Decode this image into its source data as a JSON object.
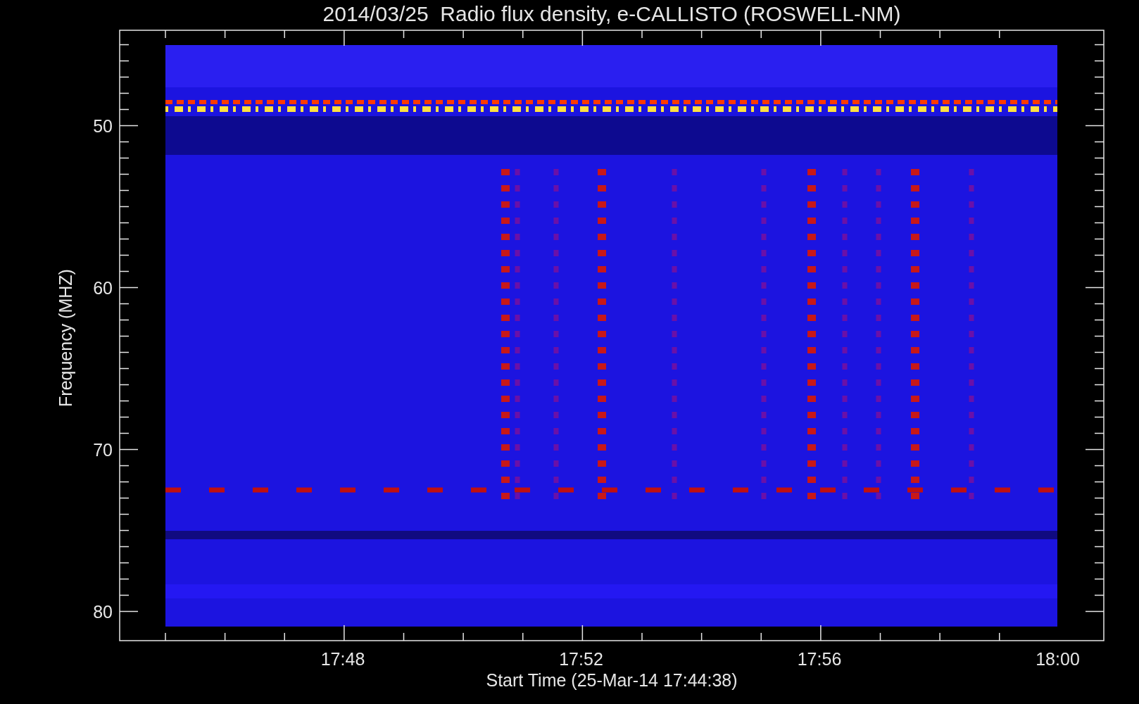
{
  "title": "2014/03/25  Radio flux density, e-CALLISTO (ROSWELL-NM)",
  "ylabel": "Frequency (MHZ)",
  "xlabel": "Start Time (25-Mar-14 17:44:38)",
  "yticks": [
    "50",
    "60",
    "70",
    "80"
  ],
  "xticks": [
    "17:48",
    "17:52",
    "17:56",
    "18:00"
  ]
}
